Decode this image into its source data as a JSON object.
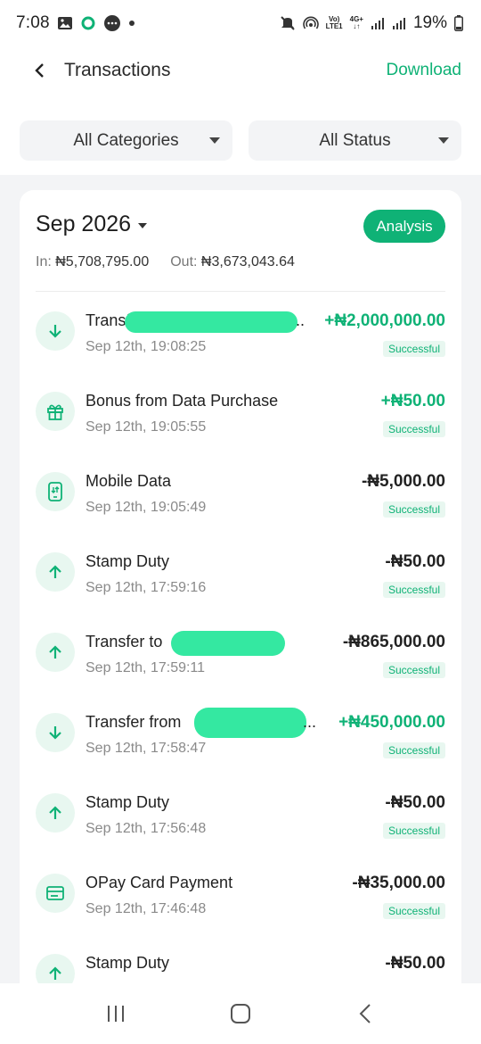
{
  "status_bar": {
    "time": "7:08",
    "battery": "19%",
    "network_top": "Vo)",
    "network_bottom": "LTE1",
    "signal_type": "4G+"
  },
  "header": {
    "title": "Transactions",
    "download_label": "Download"
  },
  "filters": {
    "categories": "All Categories",
    "status": "All Status"
  },
  "summary": {
    "month": "Sep 2026",
    "analysis_label": "Analysis",
    "in_label": "In:",
    "in_value": "₦5,708,795.00",
    "out_label": "Out:",
    "out_value": "₦3,673,043.64"
  },
  "transactions": [
    {
      "icon": "arrow-down-icon",
      "title": "Transfer from ",
      "suffix": "..",
      "date": "Sep 12th, 19:08:25",
      "amount": "+₦2,000,000.00",
      "credit": true,
      "status": "Successful"
    },
    {
      "icon": "gift-icon",
      "title": "Bonus from Data Purchase",
      "date": "Sep 12th, 19:05:55",
      "amount": "+₦50.00",
      "credit": true,
      "status": "Successful"
    },
    {
      "icon": "mobile-data-icon",
      "title": "Mobile Data",
      "date": "Sep 12th, 19:05:49",
      "amount": "-₦5,000.00",
      "credit": false,
      "status": "Successful"
    },
    {
      "icon": "arrow-up-icon",
      "title": "Stamp Duty",
      "date": "Sep 12th, 17:59:16",
      "amount": "-₦50.00",
      "credit": false,
      "status": "Successful"
    },
    {
      "icon": "arrow-up-icon",
      "title": "Transfer to ",
      "date": "Sep 12th, 17:59:11",
      "amount": "-₦865,000.00",
      "credit": false,
      "status": "Successful"
    },
    {
      "icon": "arrow-down-icon",
      "title": "Transfer from",
      "suffix": "...",
      "date": "Sep 12th, 17:58:47",
      "amount": "+₦450,000.00",
      "credit": true,
      "status": "Successful"
    },
    {
      "icon": "arrow-up-icon",
      "title": "Stamp Duty",
      "date": "Sep 12th, 17:56:48",
      "amount": "-₦50.00",
      "credit": false,
      "status": "Successful"
    },
    {
      "icon": "card-icon",
      "title": "OPay Card Payment",
      "date": "Sep 12th, 17:46:48",
      "amount": "-₦35,000.00",
      "credit": false,
      "status": "Successful"
    },
    {
      "icon": "arrow-up-icon",
      "title": "Stamp Duty",
      "date": "",
      "amount": "-₦50.00",
      "credit": false,
      "status": ""
    }
  ],
  "colors": {
    "accent": "#0fb276",
    "icon_bg": "#e8f7f0",
    "redaction": "#34e8a1"
  }
}
